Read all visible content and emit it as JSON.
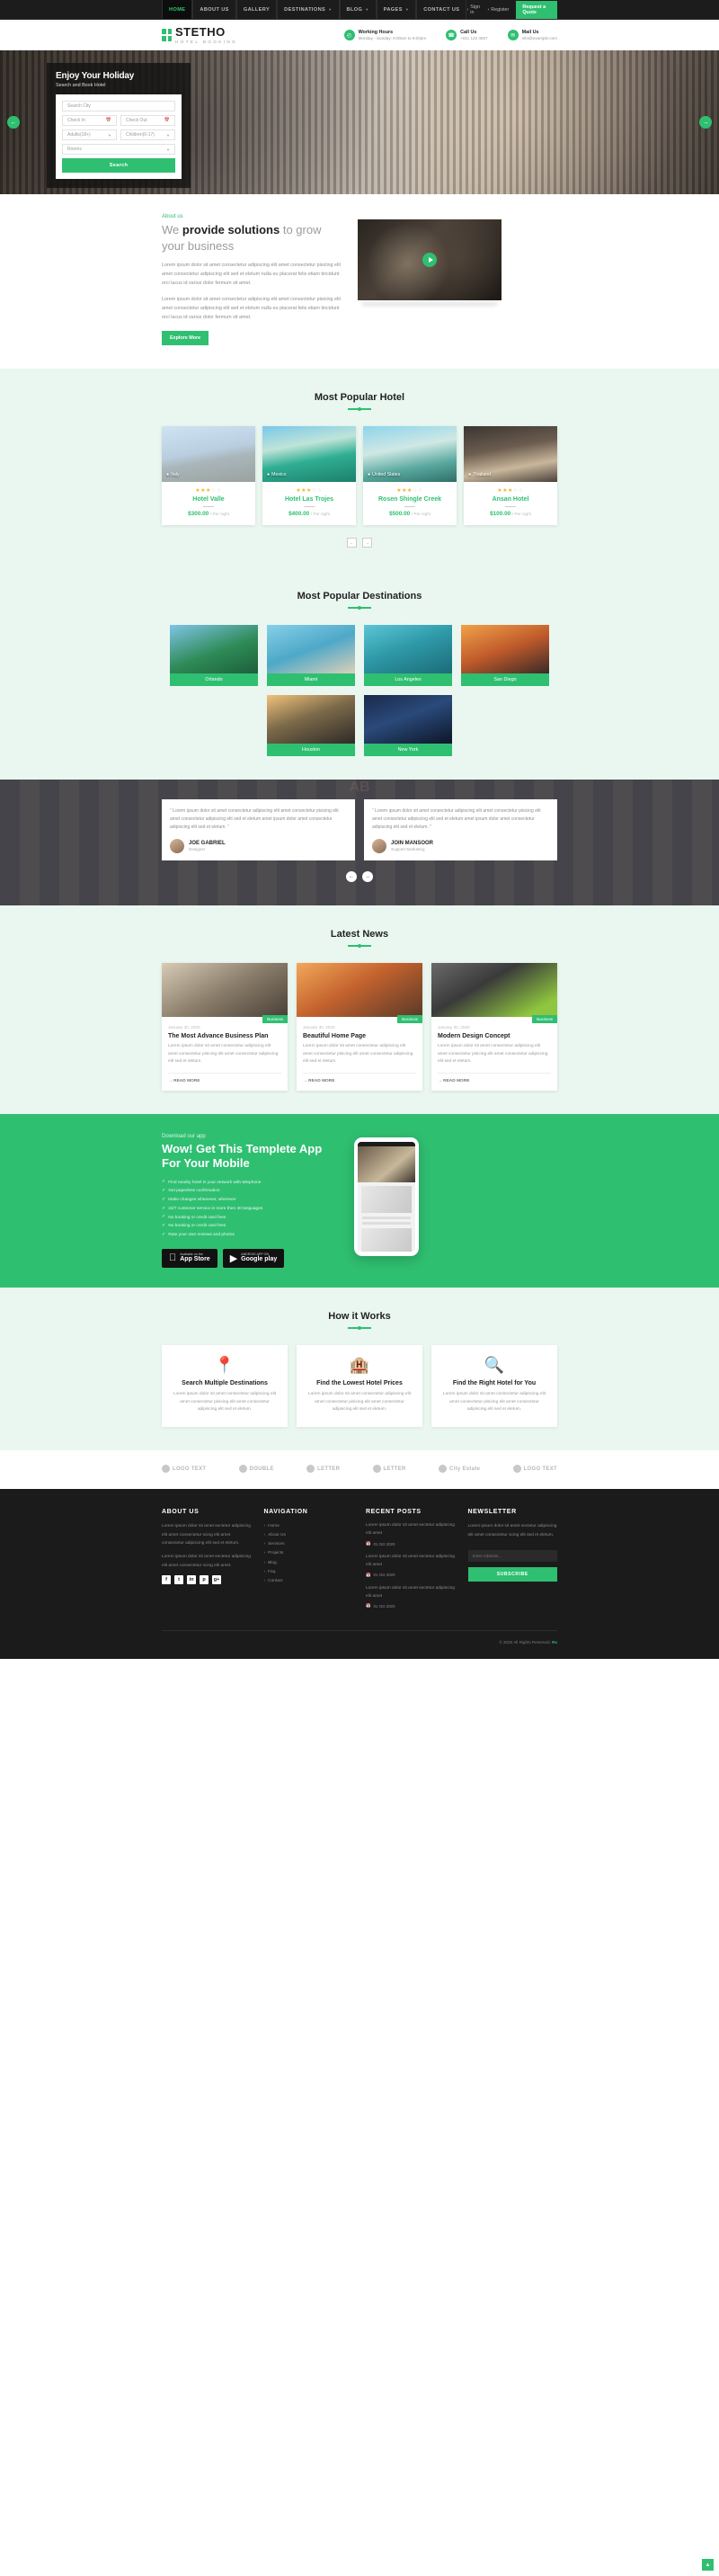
{
  "topnav": {
    "menu": [
      {
        "label": "HOME",
        "active": true,
        "caret": false
      },
      {
        "label": "ABOUT US",
        "active": false,
        "caret": false
      },
      {
        "label": "GALLERY",
        "active": false,
        "caret": false
      },
      {
        "label": "DESTINATIONS",
        "active": false,
        "caret": true
      },
      {
        "label": "BLOG",
        "active": false,
        "caret": true
      },
      {
        "label": "PAGES",
        "active": false,
        "caret": true
      },
      {
        "label": "CONTACT US",
        "active": false,
        "caret": false
      }
    ],
    "signin": "Sign in",
    "register": "Register",
    "quote": "Request a Quote"
  },
  "brand": {
    "name": "STETHO",
    "tagline": "HOTEL BOOKING"
  },
  "header_info": [
    {
      "icon": "clock-icon",
      "glyph": "◴",
      "title": "Working Hours",
      "sub": "Monday - Sunday: 9:00am to 6:00pm"
    },
    {
      "icon": "phone-icon",
      "glyph": "☎",
      "title": "Call Us",
      "sub": "+011 123 4567"
    },
    {
      "icon": "mail-icon",
      "glyph": "✉",
      "title": "Mail Us",
      "sub": "info@example.com"
    }
  ],
  "hero": {
    "title": "Enjoy Your Holiday",
    "subtitle": "Search and Book Hotel",
    "fields": {
      "city": "Search City",
      "checkin": "Check In",
      "checkout": "Check Out",
      "adults": "Adults(18+)",
      "children": "Children(0-17)",
      "rooms": "Rooms"
    },
    "search_button": "Search"
  },
  "about": {
    "eyebrow": "About us",
    "heading_pre": "We ",
    "heading_bold": "provide solutions",
    "heading_post": " to grow your business",
    "p1": "Lorem ipsum dolor sit amet consectetur adipiscing elit amet consectetur pisicing elit amet consectetur adipiscing elit sed et eletum nulla eu placerat felis etiam tincidunt orci lacus id varius dolor fermum sit amet.",
    "p2": "Lorem ipsum dolor sit amet consectetur adipiscing elit amet consectetur pisicing elit amet consectetur adipiscing elit sed et eletum nulla eu placerat felis etiam tincidunt orci lacus id varius dolor fermum sit amet.",
    "button": "Explore More"
  },
  "hotels": {
    "title": "Most Popular Hotel",
    "cards": [
      {
        "location": "Italy",
        "name": "Hotel Valle",
        "price": "$300.00",
        "per": "/ Per night",
        "stars": 3
      },
      {
        "location": "Mexico",
        "name": "Hotel Las Trojes",
        "price": "$400.00",
        "per": "/ Per night",
        "stars": 3
      },
      {
        "location": "United States",
        "name": "Rosen Shingle Creek",
        "price": "$500.00",
        "per": "/ Per night",
        "stars": 3
      },
      {
        "location": "Thailand",
        "name": "Ansan Hotel",
        "price": "$100.00",
        "per": "/ Per night",
        "stars": 3
      }
    ],
    "prev": "←",
    "next": "→"
  },
  "destinations": {
    "title": "Most Popular Destinations",
    "items": [
      {
        "label": "Orlando"
      },
      {
        "label": "Miami"
      },
      {
        "label": "Los Angeles"
      },
      {
        "label": "San Diego"
      },
      {
        "label": "Houston"
      },
      {
        "label": "New York"
      }
    ]
  },
  "testimonials": {
    "items": [
      {
        "quote": "“ Lorem ipsum dolor sit amet consectetur adipiscing elit amet consectetur pisicing elit amet consectetur adipiscing elit sed et eletum amet ipsum dolor amet consectetur adipiscing elit sed et eletum. ”",
        "name": "JOE GABRIEL",
        "role": "Designer"
      },
      {
        "quote": "“ Lorem ipsum dolor sit amet consectetur adipiscing elit amet consectetur pisicing elit amet consectetur adipiscing elit sed et eletum amet ipsum dolor amet consectetur adipiscing elit sed et eletum. ”",
        "name": "JOIN MANSOOR",
        "role": "Support Marketing"
      }
    ],
    "prev": "←",
    "next": "→"
  },
  "news": {
    "title": "Latest News",
    "items": [
      {
        "date": "January 30, 2020",
        "tag": "Business",
        "title": "The Most Advance Business Plan",
        "excerpt": "Lorem ipsum dolor sit amet consectetur adipiscing elit amet consectetur pisicing elit amet consectetur adipiscing elit sed et eletum.",
        "more": "READ MORE"
      },
      {
        "date": "January 30, 2020",
        "tag": "Business",
        "title": "Beautiful Home Page",
        "excerpt": "Lorem ipsum dolor sit amet consectetur adipiscing elit amet consectetur pisicing elit amet consectetur adipiscing elit sed et eletum.",
        "more": "READ MORE"
      },
      {
        "date": "January 30, 2020",
        "tag": "Business",
        "title": "Modern Design Concept",
        "excerpt": "Lorem ipsum dolor sit amet consectetur adipiscing elit amet consectetur pisicing elit amet consectetur adipiscing elit sed et eletum.",
        "more": "READ MORE"
      }
    ]
  },
  "app": {
    "download_label": "Download our app",
    "heading": "Wow! Get This Templete App For Your Mobile",
    "features": [
      "Find nearby hotel in your network with telephone",
      "Get paperless confirmation",
      "Make changes whenever, wherever",
      "24/7 customer service in more then 40 languages",
      "No booking or credit card fees",
      "No booking or credit card fees",
      "Rate your own reviews and photos"
    ],
    "stores": [
      {
        "icon": "apple-icon",
        "glyph": "",
        "line1": "Available on the",
        "line2": "App Store"
      },
      {
        "icon": "google-play-icon",
        "glyph": "▶",
        "line1": "ANDROID APP ON",
        "line2": "Google play"
      }
    ]
  },
  "how": {
    "title": "How it Works",
    "items": [
      {
        "icon": "map-pin-icon",
        "glyph": "📍",
        "title": "Search Multiple Destinations",
        "text": "Lorem ipsum dolor sit amet consectetur adipiscing elit amet consectetur pisicing elit amet consectetur adipiscing elit sed et eletum."
      },
      {
        "icon": "building-icon",
        "glyph": "🏨",
        "title": "Find the Lowest Hotel Prices",
        "text": "Lorem ipsum dolor sit amet consectetur adipiscing elit amet consectetur pisicing elit amet consectetur adipiscing elit sed et eletum."
      },
      {
        "icon": "search-icon",
        "glyph": "🔍",
        "title": "Find the Right Hotel for You",
        "text": "Lorem ipsum dolor sit amet consectetur adipiscing elit amet consectetur pisicing elit amet consectetur adipiscing elit sed et eletum."
      }
    ]
  },
  "brands": [
    {
      "label": "LOGO TEXT"
    },
    {
      "label": "DOUBLE"
    },
    {
      "label": "LETTER"
    },
    {
      "label": "LETTER"
    },
    {
      "label": "City Estate"
    },
    {
      "label": "LOGO TEXT"
    }
  ],
  "footer": {
    "about": {
      "title": "ABOUT US",
      "p1": "Lorem ipsum dolor sit amet sectetur adipiscing elit amet consectetur scing elit amet consectetur adipiscing elit sed et eletum.",
      "p2": "Lorem ipsum dolor sit amet sectetur adipiscing elit amet consectetur scing elit amet."
    },
    "navigation": {
      "title": "NAVIGATION",
      "items": [
        "Home",
        "About Us",
        "Services",
        "Projects",
        "Blog",
        "Faq",
        "Contact"
      ]
    },
    "posts": {
      "title": "RECENT POSTS",
      "items": [
        {
          "text": "Lorem ipsum dolor sit amet sectetur adipiscing elit amet",
          "date": "01 Oct 2020"
        },
        {
          "text": "Lorem ipsum dolor sit amet sectetur adipiscing elit amet",
          "date": "01 Oct 2020"
        },
        {
          "text": "Lorem ipsum dolor sit amet sectetur adipiscing elit amet",
          "date": "01 Oct 2020"
        }
      ]
    },
    "newsletter": {
      "title": "NEWSLETTER",
      "text": "Lorem ipsum dolor sit amet sectetur adipiscing elit amet consectetur scing elit sed et eletum.",
      "placeholder": "Enter Address...",
      "button": "SUBSCRIBE"
    },
    "social": [
      {
        "name": "facebook-icon",
        "glyph": "f"
      },
      {
        "name": "twitter-icon",
        "glyph": "t"
      },
      {
        "name": "linkedin-icon",
        "glyph": "in"
      },
      {
        "name": "pinterest-icon",
        "glyph": "p"
      },
      {
        "name": "google-plus-icon",
        "glyph": "g+"
      }
    ],
    "copyright": "© 2020 All Rights Reserved.",
    "copyright_brand": "Rs"
  },
  "colors": {
    "accent": "#2fbf71",
    "dark": "#1b1b1b",
    "light_green": "#eaf7f0"
  },
  "watermark": "AB"
}
